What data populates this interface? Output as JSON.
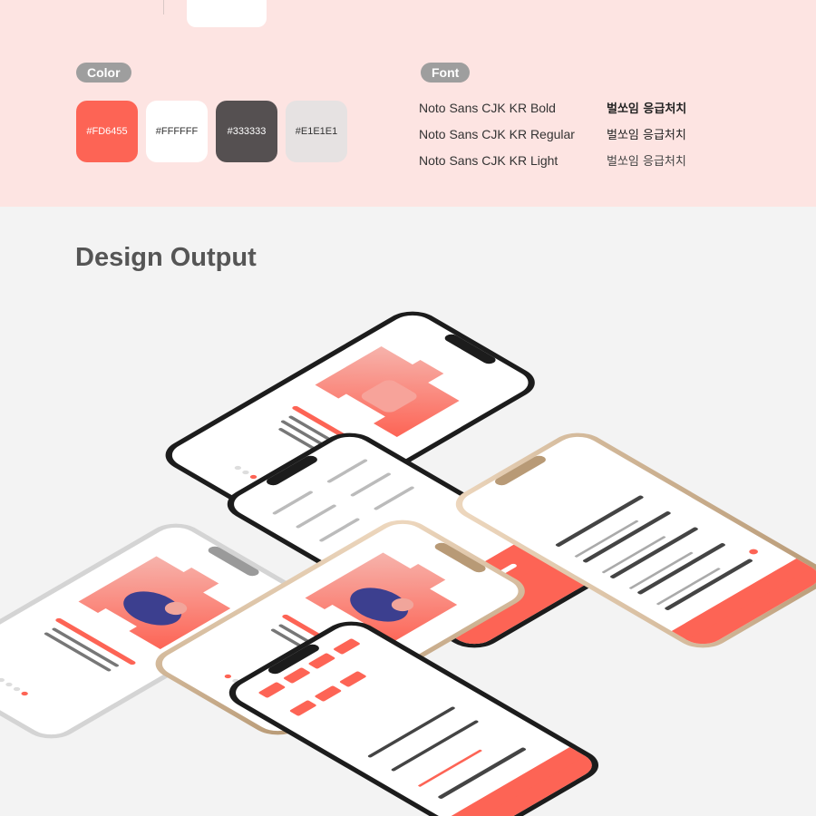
{
  "colors_section": {
    "label": "Color",
    "swatches": [
      {
        "label": "#FD6455",
        "bg": "#FD6455",
        "text_color": "#ffffff"
      },
      {
        "label": "#FFFFFF",
        "bg": "#FFFFFF",
        "text_color": "#333333"
      },
      {
        "label": "#333333",
        "bg": "#555051",
        "text_color": "#ffffff"
      },
      {
        "label": "#E1E1E1",
        "bg": "#E6E2E2",
        "text_color": "#333333"
      }
    ]
  },
  "font_section": {
    "label": "Font",
    "rows": [
      {
        "name": "Noto Sans  CJK KR Bold",
        "sample": "벌쏘임 응급처치",
        "weight": "bold"
      },
      {
        "name": "Noto Sans  CJK KR Regular",
        "sample": "벌쏘임 응급처치",
        "weight": "normal"
      },
      {
        "name": "Noto Sans  CJK KR Light",
        "sample": "벌쏘임 응급처치",
        "weight": "light"
      }
    ]
  },
  "output_section": {
    "title": "Design Output"
  },
  "theme": {
    "accent": "#FD6455",
    "band": "#fde4e2",
    "background": "#f3f3f3",
    "dark": "#333333"
  }
}
